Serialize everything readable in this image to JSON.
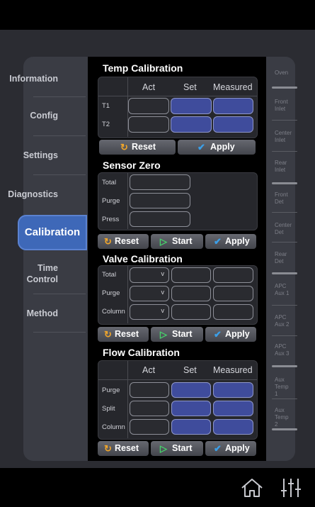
{
  "nav": {
    "items": [
      "Information",
      "Config",
      "Settings",
      "Diagnostics",
      "Calibration",
      "Time\nControl",
      "Method"
    ],
    "active": "Calibration"
  },
  "temp": {
    "title": "Temp Calibration",
    "cols": [
      "Act",
      "Set",
      "Measured"
    ],
    "rows": [
      "T1",
      "T2"
    ]
  },
  "sensor": {
    "title": "Sensor Zero",
    "rows": [
      "Total",
      "Purge",
      "Press"
    ]
  },
  "valve": {
    "title": "Valve Calibration",
    "rows": [
      "Total",
      "Purge",
      "Column"
    ],
    "dropdown_value": "v"
  },
  "flow": {
    "title": "Flow Calibration",
    "cols": [
      "Act",
      "Set",
      "Measured"
    ],
    "rows": [
      "Purge",
      "Split",
      "Column"
    ]
  },
  "buttons": {
    "reset": "Reset",
    "start": "Start",
    "apply": "Apply"
  },
  "right_nav": [
    "Oven",
    "Front Inlet",
    "Center Inlet",
    "Rear Inlet",
    "Front Det",
    "Center Det",
    "Rear Det",
    "APC Aux 1",
    "APC Aux 2",
    "APC Aux 3",
    "Aux Temp 1",
    "Aux Temp 2"
  ],
  "icons": {
    "home": "home-icon",
    "sliders": "sliders-icon"
  },
  "colors": {
    "accent": "#3e68b8",
    "cell_blue": "#3f4c9c",
    "reset": "#f0a62b",
    "start": "#46d46b",
    "apply": "#3b9fe8"
  }
}
